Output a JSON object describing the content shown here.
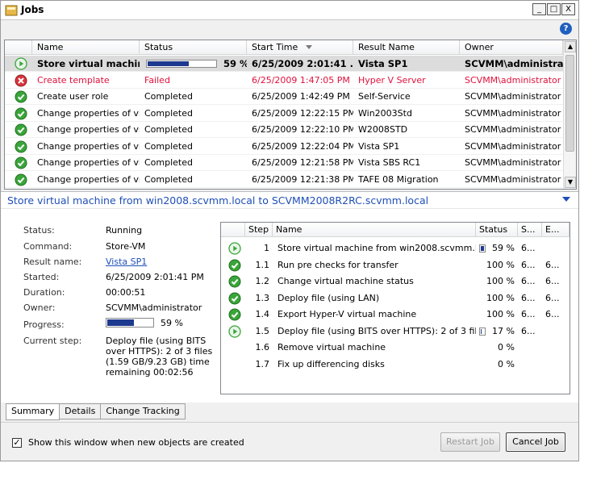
{
  "window": {
    "title": "Jobs",
    "minimize": "_",
    "maximize": "□",
    "close": "X",
    "help": "?"
  },
  "joblist": {
    "columns": [
      "Name",
      "Status",
      "Start Time",
      "Result Name",
      "Owner"
    ],
    "rows": [
      {
        "name": "Store virtual machin...",
        "status": "",
        "progress": 59,
        "progress_label": "59 %",
        "start": "6/25/2009 2:01:41 ...",
        "result": "Vista SP1",
        "owner": "SCVMM\\administrator",
        "icon": "play-icon"
      },
      {
        "name": "Create template",
        "status": "Failed",
        "start": "6/25/2009 1:47:05 PM",
        "result": "Hyper V Server",
        "owner": "SCVMM\\administrator",
        "icon": "error-icon"
      },
      {
        "name": "Create user role",
        "status": "Completed",
        "start": "6/25/2009 1:42:49 PM",
        "result": "Self-Service",
        "owner": "SCVMM\\administrator",
        "icon": "check-icon"
      },
      {
        "name": "Change properties of vi...",
        "status": "Completed",
        "start": "6/25/2009 12:22:15 PM",
        "result": "Win2003Std",
        "owner": "SCVMM\\administrator",
        "icon": "check-icon"
      },
      {
        "name": "Change properties of vi...",
        "status": "Completed",
        "start": "6/25/2009 12:22:10 PM",
        "result": "W2008STD",
        "owner": "SCVMM\\administrator",
        "icon": "check-icon"
      },
      {
        "name": "Change properties of vi...",
        "status": "Completed",
        "start": "6/25/2009 12:22:04 PM",
        "result": "Vista SP1",
        "owner": "SCVMM\\administrator",
        "icon": "check-icon"
      },
      {
        "name": "Change properties of vi...",
        "status": "Completed",
        "start": "6/25/2009 12:21:58 PM",
        "result": "Vista SBS RC1",
        "owner": "SCVMM\\administrator",
        "icon": "check-icon"
      },
      {
        "name": "Change properties of vi...",
        "status": "Completed",
        "start": "6/25/2009 12:21:38 PM",
        "result": "TAFE 08 Migration",
        "owner": "SCVMM\\administrator",
        "icon": "check-icon"
      }
    ]
  },
  "detail": {
    "header": "Store virtual machine from win2008.scvmm.local to SCVMM2008R2RC.scvmm.local",
    "labels": {
      "status": "Status:",
      "command": "Command:",
      "result_name": "Result name:",
      "started": "Started:",
      "duration": "Duration:",
      "owner": "Owner:",
      "progress": "Progress:",
      "current_step": "Current step:"
    },
    "values": {
      "status": "Running",
      "command": "Store-VM",
      "result_name": "Vista SP1",
      "started": "6/25/2009 2:01:41 PM",
      "duration": "00:00:51",
      "owner": "SCVMM\\administrator",
      "progress": 59,
      "progress_label": "59 %",
      "current_step": "Deploy file (using BITS over HTTPS): 2 of 3 files (1.59 GB/9.23 GB) time remaining 00:02:56"
    },
    "steps": {
      "columns": [
        "Step",
        "Name",
        "Status",
        "S...",
        "E..."
      ],
      "rows": [
        {
          "step": "1",
          "name": "Store virtual machine from win2008.scvmm.local t...",
          "status": "59 %",
          "bar": 59,
          "s": "6...",
          "e": "",
          "icon": "play-icon"
        },
        {
          "step": "1.1",
          "name": "Run pre checks for transfer",
          "status": "100 %",
          "s": "6...",
          "e": "6...",
          "icon": "check-icon"
        },
        {
          "step": "1.2",
          "name": "Change virtual machine status",
          "status": "100 %",
          "s": "6...",
          "e": "6...",
          "icon": "check-icon"
        },
        {
          "step": "1.3",
          "name": "Deploy file (using LAN)",
          "status": "100 %",
          "s": "6...",
          "e": "6...",
          "icon": "check-icon"
        },
        {
          "step": "1.4",
          "name": "Export Hyper-V virtual machine",
          "status": "100 %",
          "s": "6...",
          "e": "6...",
          "icon": "check-icon"
        },
        {
          "step": "1.5",
          "name": "Deploy file (using BITS over HTTPS): 2 of 3 files (...",
          "status": "17 %",
          "bar": 17,
          "s": "6...",
          "e": "",
          "icon": "play-icon"
        },
        {
          "step": "1.6",
          "name": "Remove virtual machine",
          "status": "0 %",
          "s": "",
          "e": "",
          "icon": ""
        },
        {
          "step": "1.7",
          "name": "Fix up differencing disks",
          "status": "0 %",
          "s": "",
          "e": "",
          "icon": ""
        }
      ]
    }
  },
  "tabs": [
    "Summary",
    "Details",
    "Change Tracking"
  ],
  "bottom": {
    "checkbox_label": "Show this window when new objects are created",
    "checkbox_mark": "✓",
    "restart_label": "Restart Job",
    "cancel_label": "Cancel Job"
  }
}
